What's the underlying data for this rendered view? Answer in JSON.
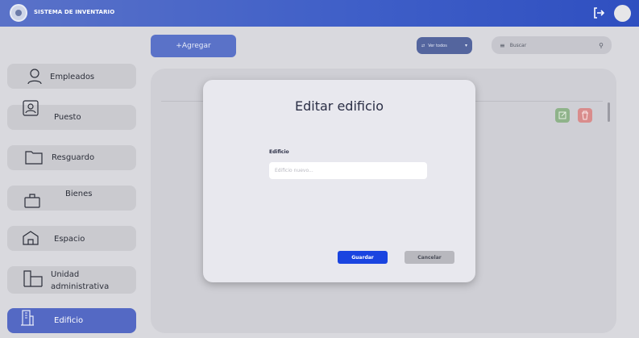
{
  "header": {
    "app_title": "SISTEMA DE INVENTARIO",
    "logo_icon": "seal-logo-icon",
    "logout_icon": "logout-icon",
    "avatar_icon": "user-avatar-icon"
  },
  "toolbar": {
    "add_label": "+Agregar",
    "filter_label": "Ver todos",
    "search_placeholder": "Buscar"
  },
  "sidebar": {
    "items": [
      {
        "label": "Empleados",
        "icon": "person-icon"
      },
      {
        "label": "Puesto",
        "icon": "id-card-icon"
      },
      {
        "label": "Resguardo",
        "icon": "folder-icon"
      },
      {
        "label": "Bienes",
        "icon": "briefcase-icon"
      },
      {
        "label": "Espacio",
        "icon": "house-icon"
      },
      {
        "label": "Unidad administrativa",
        "icon": "building-icon"
      },
      {
        "label": "Edificio",
        "icon": "tower-icon",
        "active": true
      }
    ]
  },
  "modal": {
    "title": "Editar edificio",
    "field_label": "Edificio",
    "field_placeholder": "Edificio nuevo...",
    "field_value": "",
    "save_label": "Guardar",
    "cancel_label": "Cancelar"
  },
  "colors": {
    "topbar": "#3f5fc8",
    "accent": "#5469c4",
    "save": "#1a44e0",
    "edit": "#8fb38a",
    "delete": "#d98c8c"
  }
}
